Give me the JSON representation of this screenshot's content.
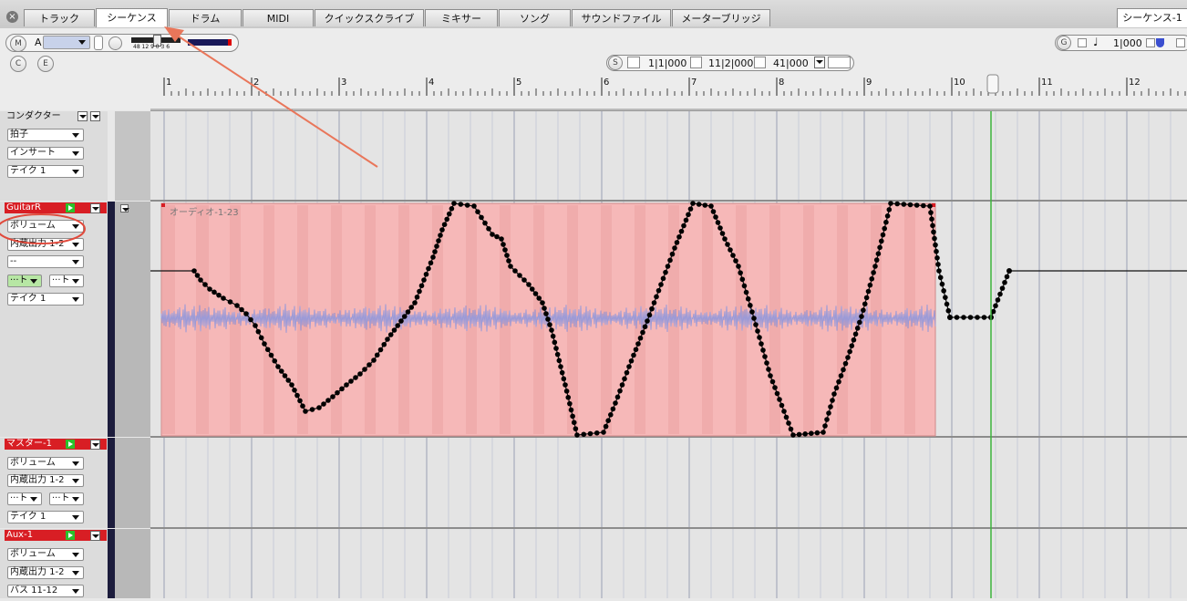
{
  "tabs": [
    {
      "label": "トラック"
    },
    {
      "label": "シーケンス"
    },
    {
      "label": "ドラム"
    },
    {
      "label": "MIDI"
    },
    {
      "label": "クイックスクライブ"
    },
    {
      "label": "ミキサー"
    },
    {
      "label": "ソング"
    },
    {
      "label": "サウンドファイル"
    },
    {
      "label": "メーターブリッジ"
    }
  ],
  "window_title": "シーケンス-1",
  "toolbar": {
    "m_label": "M",
    "a_label": "A",
    "c_label": "C",
    "e_label": "E",
    "meter_ticks": "48 12 9 0 3 6",
    "g_label": "G",
    "right_counter": "1|000",
    "s_label": "S",
    "loc_start": "1|1|000",
    "loc_mid": "11|2|000",
    "loc_end": "41|000"
  },
  "ruler": {
    "bars": [
      "1",
      "2",
      "3",
      "4",
      "5",
      "6",
      "7",
      "8",
      "9",
      "10",
      "11",
      "12"
    ]
  },
  "tracks": {
    "conductor": {
      "title": "コンダクター",
      "selects": [
        "拍子",
        "インサート",
        "テイク 1"
      ]
    },
    "guitar": {
      "title": "GuitarR",
      "selects": [
        "ボリューム",
        "内蔵出力 1-2",
        "--"
      ],
      "small_a": "···ト",
      "small_b": "···ト",
      "take": "テイク 1",
      "region_name": "オーディオ-1-23"
    },
    "master": {
      "title": "マスター-1",
      "selects": [
        "ボリューム",
        "内蔵出力 1-2"
      ],
      "small_a": "···ト",
      "small_b": "···ト",
      "take": "テイク 1"
    },
    "aux": {
      "title": "Aux-1",
      "selects": [
        "ボリューム",
        "内蔵出力 1-2",
        "バス 11-12"
      ]
    }
  },
  "colors": {
    "region": "#f6b8b8",
    "track_red": "#d81e24",
    "playhead": "#3cb43c",
    "annotation": "#e9765a",
    "waveform": "#9a9ad8"
  }
}
